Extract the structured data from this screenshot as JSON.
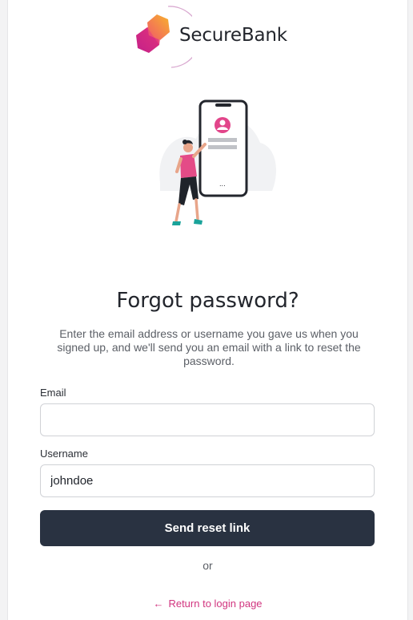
{
  "brand": {
    "name": "SecureBank"
  },
  "page": {
    "title": "Forgot password?",
    "description": "Enter the email address or username you gave us when you signed up, and we'll send you an email with a link to reset the password."
  },
  "form": {
    "email_label": "Email",
    "email_value": "",
    "username_label": "Username",
    "username_value": "johndoe",
    "submit_label": "Send reset link"
  },
  "divider_text": "or",
  "return_link": {
    "label": "Return to login page",
    "icon": "arrow-left-icon"
  },
  "colors": {
    "accent": "#d1357f",
    "button": "#293241",
    "logo_magenta": "#c4208a",
    "logo_orange": "#f6a623"
  }
}
